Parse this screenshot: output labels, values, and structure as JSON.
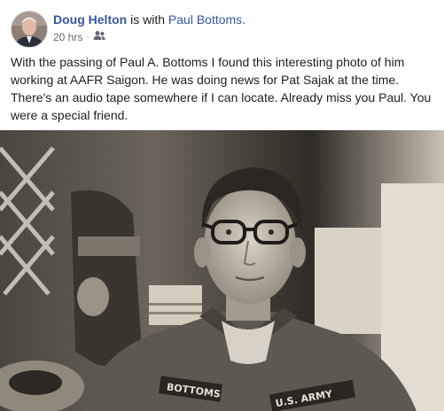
{
  "post": {
    "author": "Doug Helton",
    "with_text": "is with",
    "tagged": "Paul Bottoms.",
    "time": "20 hrs",
    "separator": "·",
    "audience_icon": "friends-icon",
    "body": "With the passing of Paul A. Bottoms I found this interesting photo of him working at AAFR Saigon. He was doing news for Pat Sajak at the time. There's an audio tape somewhere if I can locate. Already miss you Paul. You were a special friend."
  },
  "photo": {
    "name_tape": "BOTTOMS",
    "army_tape": "U.S. ARMY",
    "colors": {
      "sepia_dark": "#2e2a25",
      "sepia_mid": "#6b655b",
      "sepia_light": "#c9c1b2"
    }
  }
}
